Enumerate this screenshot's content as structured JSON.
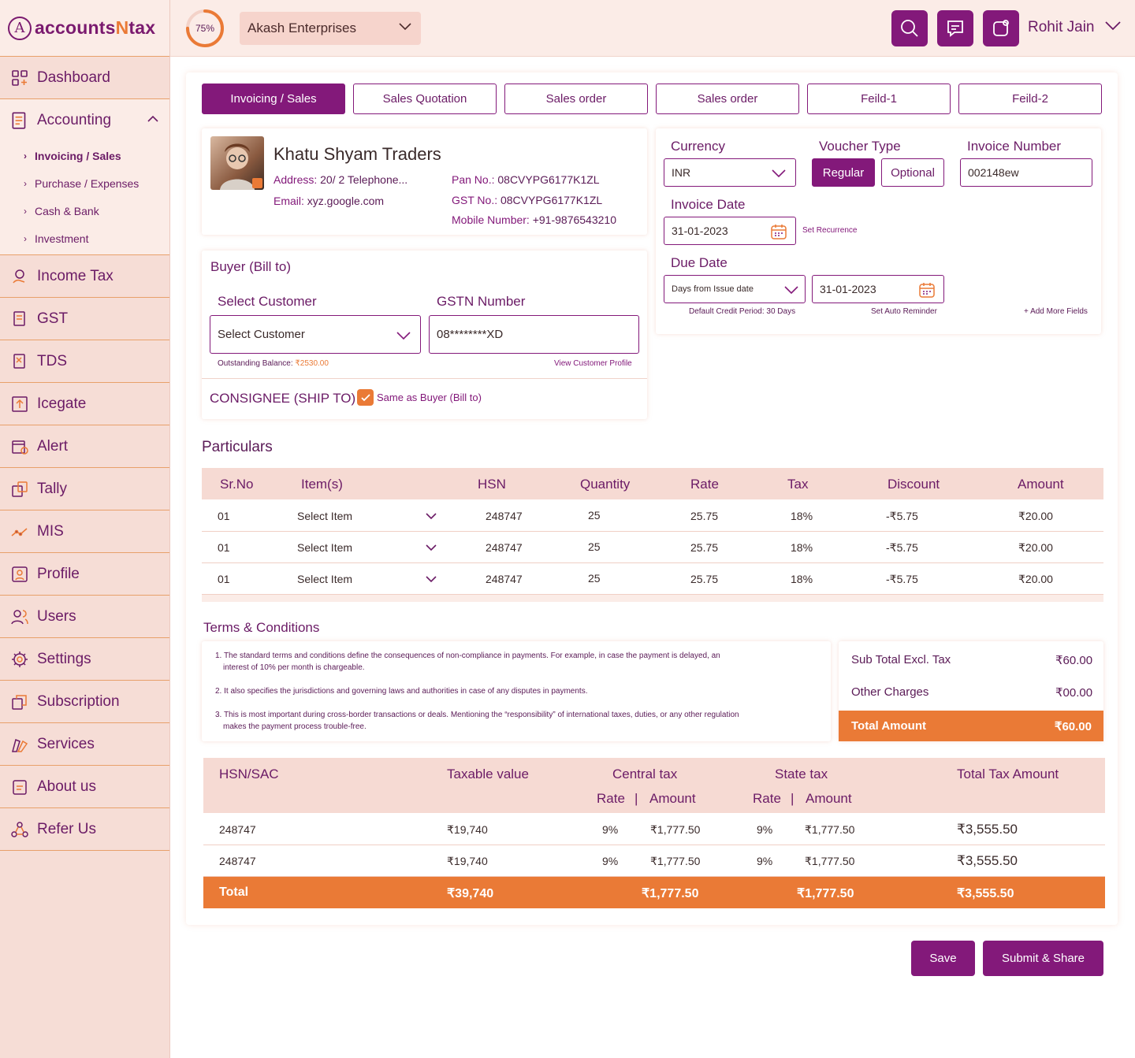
{
  "brand": {
    "prefix": "accounts",
    "n": "N",
    "suffix": "tax"
  },
  "sidebar": {
    "dashboard": "Dashboard",
    "accounting": "Accounting",
    "accounting_sub": [
      "Invoicing / Sales",
      "Purchase / Expenses",
      "Cash & Bank",
      "Investment"
    ],
    "items": [
      "Income Tax",
      "GST",
      "TDS",
      "Icegate",
      "Alert",
      "Tally",
      "MIS",
      "Profile",
      "Users",
      "Settings",
      "Subscription",
      "Services",
      "About us",
      "Refer Us"
    ]
  },
  "topbar": {
    "progress_label": "75%",
    "progress_value": 0.75,
    "company": "Akash Enterprises",
    "user": "Rohit Jain",
    "icons": [
      "search-icon",
      "chat-icon",
      "notification-icon"
    ]
  },
  "tabs": [
    "Invoicing / Sales",
    "Sales Quotation",
    "Sales order",
    "Sales order",
    "Feild-1",
    "Feild-2"
  ],
  "seller": {
    "name": "Khatu Shyam Traders",
    "address_label": "Address:",
    "address": "20/ 2 Telephone...",
    "email_label": "Email:",
    "email": "xyz.google.com",
    "pan_label": "Pan No.:",
    "pan": "08CVYPG6177K1ZL",
    "gst_label": "GST No.:",
    "gst": "08CVYPG6177K1ZL",
    "mobile_label": "Mobile Number:",
    "mobile": "+91-9876543210"
  },
  "invoice": {
    "currency_label": "Currency",
    "currency": "INR",
    "voucher_label": "Voucher Type",
    "voucher_regular": "Regular",
    "voucher_optional": "Optional",
    "number_label": "Invoice Number",
    "number": "002148ew",
    "date_label": "Invoice Date",
    "date": "31-01-2023",
    "recurrence": "Set Recurrence",
    "due_label": "Due Date",
    "due_mode": "Days from Issue date",
    "due_date": "31-01-2023",
    "credit_period": "Default Credit Period: 30 Days",
    "auto_reminder": "Set Auto Reminder",
    "add_fields": "+ Add More Fields"
  },
  "buyer": {
    "title": "Buyer (Bill to)",
    "customer_label": "Select Customer",
    "customer_value": "Select Customer",
    "gstn_label": "GSTN Number",
    "gstn_value": "08********XD",
    "balance_label": "Outstanding Balance:",
    "balance": "₹2530.00",
    "view_profile": "View Customer Profile",
    "consignee": "CONSIGNEE (SHIP TO)",
    "same_as": "Same as Buyer (Bill to)"
  },
  "particulars": {
    "title": "Particulars",
    "headers": [
      "Sr.No",
      "Item(s)",
      "HSN",
      "Quantity",
      "Rate",
      "Tax",
      "Discount",
      "Amount"
    ],
    "rows": [
      {
        "sr": "01",
        "item": "Select Item",
        "hsn": "248747",
        "qty": "25",
        "rate": "25.75",
        "tax": "18%",
        "discount": "-₹5.75",
        "amount": "₹20.00"
      },
      {
        "sr": "01",
        "item": "Select Item",
        "hsn": "248747",
        "qty": "25",
        "rate": "25.75",
        "tax": "18%",
        "discount": "-₹5.75",
        "amount": "₹20.00"
      },
      {
        "sr": "01",
        "item": "Select Item",
        "hsn": "248747",
        "qty": "25",
        "rate": "25.75",
        "tax": "18%",
        "discount": "-₹5.75",
        "amount": "₹20.00"
      }
    ]
  },
  "terms": {
    "title": "Terms & Conditions",
    "items": [
      "1. The standard terms and conditions define the consequences of non-compliance in payments. For example, in case the payment is delayed, an",
      "interest of 10% per month is chargeable.",
      "2. It also specifies the jurisdictions and governing laws and authorities in case of any disputes in payments.",
      "3. This is most important during cross-border transactions or deals. Mentioning the “responsibility” of international taxes, duties, or any other regulation",
      "makes the payment process trouble-free."
    ]
  },
  "summary": {
    "subtotal_label": "Sub Total  Excl. Tax",
    "subtotal": "₹60.00",
    "other_label": "Other Charges",
    "other": "₹00.00",
    "total_label": "Total Amount",
    "total": "₹60.00"
  },
  "tax_table": {
    "headers": {
      "hsn": "HSN/SAC",
      "taxable": "Taxable value",
      "central": "Central tax",
      "state": "State tax",
      "total": "Total Tax Amount",
      "rate": "Rate",
      "sep": "|",
      "amount": "Amount"
    },
    "rows": [
      {
        "hsn": "248747",
        "taxable": "₹19,740",
        "c_rate": "9%",
        "c_amt": "₹1,777.50",
        "s_rate": "9%",
        "s_amt": "₹1,777.50",
        "total": "₹3,555.50"
      },
      {
        "hsn": "248747",
        "taxable": "₹19,740",
        "c_rate": "9%",
        "c_amt": "₹1,777.50",
        "s_rate": "9%",
        "s_amt": "₹1,777.50",
        "total": "₹3,555.50"
      }
    ],
    "total": {
      "label": "Total",
      "taxable": "₹39,740",
      "central": "₹1,777.50",
      "state": "₹1,777.50",
      "total": "₹3,555.50"
    }
  },
  "actions": {
    "save": "Save",
    "submit": "Submit & Share"
  },
  "colors": {
    "primary": "#83197a",
    "accent": "#ea7a36",
    "sidebar": "#f6ddd6"
  }
}
